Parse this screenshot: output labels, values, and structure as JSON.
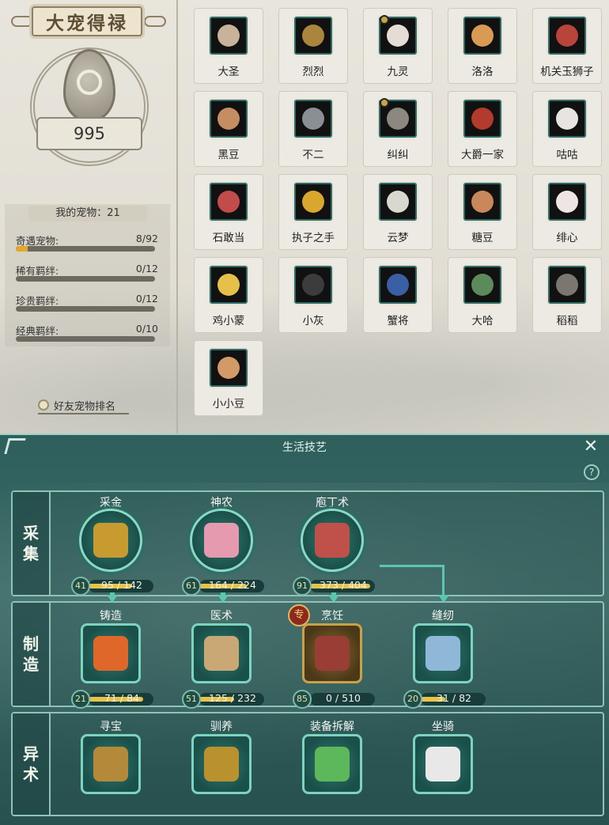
{
  "left": {
    "title": "大宠得禄",
    "score": "995",
    "my_pets_label": "我的宠物：21",
    "stats": [
      {
        "label": "奇遇宠物:",
        "value": "8/92",
        "ratio": 0.087
      },
      {
        "label": "稀有羁绊:",
        "value": "0/12",
        "ratio": 0
      },
      {
        "label": "珍贵羁绊:",
        "value": "0/12",
        "ratio": 0
      },
      {
        "label": "经典羁绊:",
        "value": "0/10",
        "ratio": 0
      }
    ],
    "friend_rank": "好友宠物排名"
  },
  "pets": [
    {
      "name": "大圣",
      "icon": "monkey-icon",
      "color": "#c8b39a"
    },
    {
      "name": "烈烈",
      "icon": "dog-icon",
      "color": "#a9853d"
    },
    {
      "name": "九灵",
      "icon": "fox-icon",
      "color": "#e6dcd6",
      "key": true
    },
    {
      "name": "洛洛",
      "icon": "corgi-icon",
      "color": "#d99a54"
    },
    {
      "name": "机关玉狮子",
      "icon": "lion-icon",
      "color": "#b8443c"
    },
    {
      "name": "黑豆",
      "icon": "hamster-icon",
      "color": "#c48e62"
    },
    {
      "name": "不二",
      "icon": "hat-creature-icon",
      "color": "#8a8f95"
    },
    {
      "name": "纠纠",
      "icon": "rat-icon",
      "color": "#8c8880",
      "key": true
    },
    {
      "name": "大爵一家",
      "icon": "rooster-icon",
      "color": "#b23b2e"
    },
    {
      "name": "咕咕",
      "icon": "pigeon-icon",
      "color": "#e8e4e2"
    },
    {
      "name": "石敢当",
      "icon": "panda-cart-icon",
      "color": "#c24b4b"
    },
    {
      "name": "执子之手",
      "icon": "lantern-icon",
      "color": "#d9a62e"
    },
    {
      "name": "云梦",
      "icon": "deer-icon",
      "color": "#d8d8cf"
    },
    {
      "name": "糖豆",
      "icon": "hamster-icon",
      "color": "#c9875a"
    },
    {
      "name": "绯心",
      "icon": "rabbit-icon",
      "color": "#eee6e4"
    },
    {
      "name": "鸡小蒙",
      "icon": "chick-icon",
      "color": "#e6c14a"
    },
    {
      "name": "小灰",
      "icon": "goose-icon",
      "color": "#3c3c3c"
    },
    {
      "name": "蟹将",
      "icon": "crab-icon",
      "color": "#3b5fa5"
    },
    {
      "name": "大哈",
      "icon": "frog-icon",
      "color": "#5d8a5a"
    },
    {
      "name": "稻稻",
      "icon": "raccoon-icon",
      "color": "#7c7670"
    },
    {
      "name": "小小豆",
      "icon": "hamster-icon",
      "color": "#d29a66"
    }
  ],
  "skills": {
    "title": "生活技艺",
    "rows": [
      {
        "label": [
          "采",
          "集"
        ],
        "items": [
          {
            "name": "采金",
            "icon": "pickaxe-icon",
            "level": "41",
            "progress": "95 / 142",
            "ratio": 0.669,
            "color": "#c79b30"
          },
          {
            "name": "神农",
            "icon": "herb-shovel-icon",
            "level": "61",
            "progress": "164 / 224",
            "ratio": 0.732,
            "color": "#e59ab0"
          },
          {
            "name": "庖丁术",
            "icon": "meat-cleaver-icon",
            "level": "91",
            "progress": "373 / 404",
            "ratio": 0.923,
            "color": "#c0504a"
          }
        ]
      },
      {
        "label": [
          "制",
          "造"
        ],
        "items": [
          {
            "name": "铸造",
            "icon": "anvil-icon",
            "level": "21",
            "progress": "71 / 84",
            "ratio": 0.845,
            "color": "#e0672a"
          },
          {
            "name": "医术",
            "icon": "medicine-pack-icon",
            "level": "51",
            "progress": "125 / 232",
            "ratio": 0.539,
            "color": "#c9a875"
          },
          {
            "name": "烹饪",
            "icon": "wok-icon",
            "level": "85",
            "progress": "0 / 510",
            "ratio": 0,
            "color": "#9a3d34",
            "special": "专"
          },
          {
            "name": "缝纫",
            "icon": "needle-icon",
            "level": "20",
            "progress": "31 / 82",
            "ratio": 0.378,
            "color": "#8fb7d8"
          }
        ]
      },
      {
        "label": [
          "异",
          "术"
        ],
        "items": [
          {
            "name": "寻宝",
            "icon": "treasure-table-icon",
            "color": "#b48a3a"
          },
          {
            "name": "驯养",
            "icon": "bell-collar-icon",
            "color": "#b9912e"
          },
          {
            "name": "装备拆解",
            "icon": "disassemble-icon",
            "color": "#5cb85a"
          },
          {
            "name": "坐骑",
            "icon": "horse-icon",
            "color": "#e8e8e8"
          }
        ]
      }
    ]
  }
}
